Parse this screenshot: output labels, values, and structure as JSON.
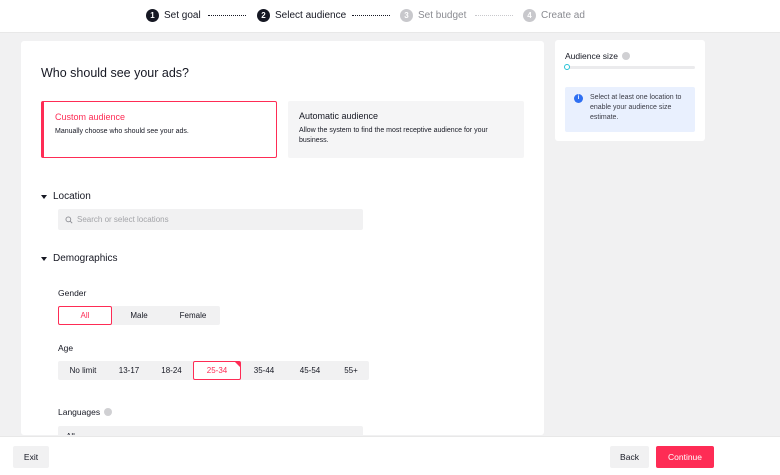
{
  "stepper": {
    "steps": [
      {
        "num": "1",
        "label": "Set goal",
        "state": "done"
      },
      {
        "num": "2",
        "label": "Select audience",
        "state": "active"
      },
      {
        "num": "3",
        "label": "Set budget",
        "state": "todo"
      },
      {
        "num": "4",
        "label": "Create ad",
        "state": "todo"
      }
    ]
  },
  "main": {
    "title": "Who should see your ads?",
    "custom": {
      "title": "Custom audience",
      "desc": "Manually choose who should see your ads."
    },
    "automatic": {
      "title": "Automatic audience",
      "desc": "Allow the system to find the most receptive audience for your business."
    },
    "location": {
      "label": "Location",
      "search_placeholder": "Search or select locations"
    },
    "demographics": {
      "label": "Demographics",
      "gender": {
        "label": "Gender",
        "options": [
          "All",
          "Male",
          "Female"
        ],
        "selected": "All"
      },
      "age": {
        "label": "Age",
        "options": [
          "No limit",
          "13-17",
          "18-24",
          "25-34",
          "35-44",
          "45-54",
          "55+"
        ],
        "selected": "25-34"
      },
      "languages": {
        "label": "Languages",
        "value": "All"
      }
    }
  },
  "side": {
    "title": "Audience size",
    "progress": 0,
    "notice": "Select at least one location to enable your audience size estimate."
  },
  "footer": {
    "exit": "Exit",
    "back": "Back",
    "continue": "Continue"
  },
  "colors": {
    "accent": "#fe2c55",
    "gauge": "#25c2d6",
    "info": "#2e6ff2"
  }
}
